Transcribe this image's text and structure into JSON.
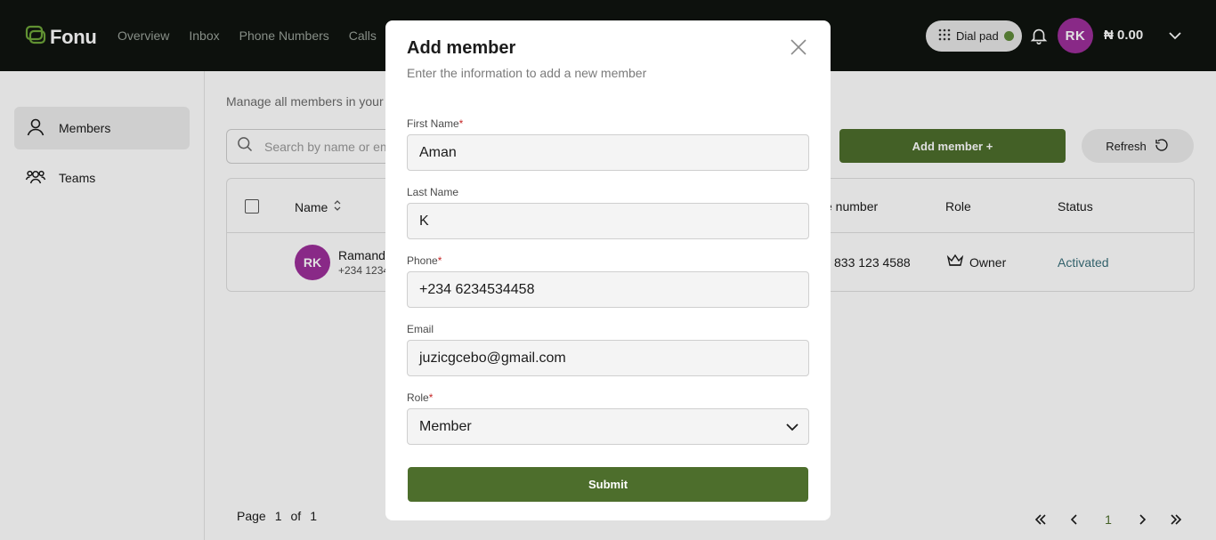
{
  "app": {
    "brand": "Fonu",
    "nav": [
      "Overview",
      "Inbox",
      "Phone Numbers",
      "Calls"
    ],
    "dialpad_label": "Dial pad",
    "user_initials": "RK",
    "balance": "₦ 0.00"
  },
  "sidebar": {
    "items": [
      {
        "label": "Members",
        "icon": "user-icon",
        "active": true
      },
      {
        "label": "Teams",
        "icon": "users-icon",
        "active": false
      }
    ]
  },
  "main": {
    "description": "Manage all members in your",
    "search_placeholder": "Search by name or em",
    "add_button": "Add member +",
    "refresh_button": "Refresh",
    "table": {
      "headers": {
        "name": "Name",
        "phone": "e number",
        "role": "Role",
        "status": "Status"
      },
      "rows": [
        {
          "initials": "RK",
          "name": "Ramand",
          "sub": "+234 1234",
          "phone": "833 123 4588",
          "role": "Owner",
          "status": "Activated"
        }
      ]
    },
    "pagination": {
      "page_word": "Page",
      "current": "1",
      "of_word": "of",
      "total": "1"
    }
  },
  "modal": {
    "title": "Add member",
    "subtitle": "Enter the information to add a new member",
    "fields": [
      {
        "label": "First Name",
        "required": true,
        "value": "Aman"
      },
      {
        "label": "Last Name",
        "required": false,
        "value": "K"
      },
      {
        "label": "Phone",
        "required": true,
        "value": "+234 6234534458"
      },
      {
        "label": "Email",
        "required": false,
        "value": "juzicgcebo@gmail.com"
      },
      {
        "label": "Role",
        "required": true,
        "value": "Member"
      }
    ],
    "submit_label": "Submit",
    "required_mark": "*"
  },
  "colors": {
    "brand_green": "#4d6e2c",
    "avatar_purple": "#9c2f9a",
    "status_teal": "#3a6f7a",
    "topbar": "#0f140f"
  }
}
